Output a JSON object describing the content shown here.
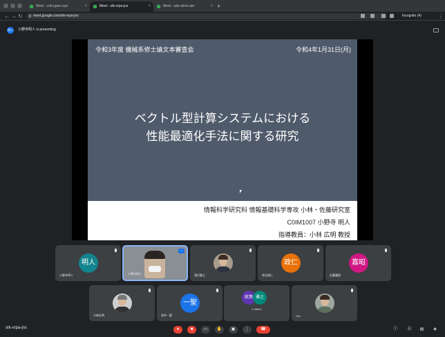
{
  "browser": {
    "tabs": [
      {
        "label": "Meet - cnb-ypac-ruyt",
        "active": false
      },
      {
        "label": "Meet - stk-vrpa-jns",
        "active": true
      },
      {
        "label": "Meet - udv-xkmv-aio",
        "active": false
      }
    ],
    "url": "meet.google.com/stk-vrpa-jns",
    "incognito_label": "Incognito (4)"
  },
  "meet": {
    "presenter_initials": "明人",
    "presenting_text": "小野寺明人 is presenting",
    "slide": {
      "header_left": "令和3年度 機械系修士論文本審査会",
      "header_right": "令和4年1月31日(月)",
      "title_line1": "ベクトル型計算システムにおける",
      "title_line2": "性能最適化手法に関する研究",
      "footer_line1": "情報科学研究科 情報基礎科学専攻 小林・佐藤研究室",
      "footer_line2": "C0IM1007 小野寺 明人",
      "footer_line3": "指導教員：小林 広明 教授"
    },
    "participants": [
      {
        "name": "小野寺明人",
        "initials": "明人",
        "color": "#12848e"
      },
      {
        "name": "小野寺明人",
        "initials": "",
        "color": ""
      },
      {
        "name": "滝沢寛之",
        "initials": "",
        "color": ""
      },
      {
        "name": "笹谷政仁",
        "initials": "政仁",
        "color": "#e8710a"
      },
      {
        "name": "近藤嘉昭",
        "initials": "嘉昭",
        "color": "#d01884"
      },
      {
        "name": "小林広明",
        "initials": "",
        "color": ""
      },
      {
        "name": "深井一聖",
        "initials": "一聖",
        "color": "#1a73e8"
      },
      {
        "name": "2 others",
        "initials_a": "航勢",
        "initials_b": "雅之",
        "color": ""
      },
      {
        "name": "You",
        "initials": "",
        "color": ""
      }
    ],
    "meeting_code": "stk-vrpa-jns"
  }
}
